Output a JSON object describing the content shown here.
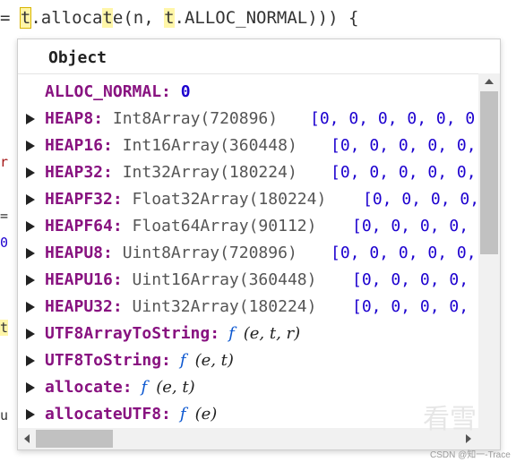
{
  "editor": {
    "line_prefix": "= ",
    "tok_t1": "t",
    "tok_dot_alloc": ".alloca",
    "tok_t2": "t",
    "tok_e_paren": "e(n, ",
    "tok_t3": "t",
    "tok_rest": ".ALLOC_NORMAL))) {",
    "left_fragments": [
      "r",
      "=",
      "0",
      "t",
      "u"
    ]
  },
  "popup": {
    "title": "Object",
    "rows": [
      {
        "key": "ALLOC_NORMAL",
        "value": "0",
        "expandable": false
      },
      {
        "key": "HEAP8",
        "type": "Int8Array(720896)",
        "preview": "[0, 0, 0, 0, 0, 0",
        "expandable": true
      },
      {
        "key": "HEAP16",
        "type": "Int16Array(360448)",
        "preview": "[0, 0, 0, 0, 0,",
        "expandable": true
      },
      {
        "key": "HEAP32",
        "type": "Int32Array(180224)",
        "preview": "[0, 0, 0, 0, 0,",
        "expandable": true
      },
      {
        "key": "HEAPF32",
        "type": "Float32Array(180224)",
        "preview": "[0, 0, 0, 0,",
        "expandable": true
      },
      {
        "key": "HEAPF64",
        "type": "Float64Array(90112)",
        "preview": "[0, 0, 0, 0,",
        "expandable": true
      },
      {
        "key": "HEAPU8",
        "type": "Uint8Array(720896)",
        "preview": "[0, 0, 0, 0, 0,",
        "expandable": true
      },
      {
        "key": "HEAPU16",
        "type": "Uint16Array(360448)",
        "preview": "[0, 0, 0, 0,",
        "expandable": true
      },
      {
        "key": "HEAPU32",
        "type": "Uint32Array(180224)",
        "preview": "[0, 0, 0, 0,",
        "expandable": true
      },
      {
        "key": "UTF8ArrayToString",
        "fn": "f",
        "args": "(e, t, r)",
        "expandable": true
      },
      {
        "key": "UTF8ToString",
        "fn": "f",
        "args": "(e, t)",
        "expandable": true
      },
      {
        "key": "allocate",
        "fn": "f",
        "args": "(e, t)",
        "expandable": true
      },
      {
        "key": "allocateUTF8",
        "fn": "f",
        "args": "(e)",
        "expandable": true
      }
    ]
  },
  "watermark": {
    "logo": "看雪",
    "text": "CSDN @知一-Trace"
  },
  "colors": {
    "key": "#881280",
    "number": "#1c00cf",
    "function": "#0b57d0",
    "highlight": "#fff6a8"
  }
}
